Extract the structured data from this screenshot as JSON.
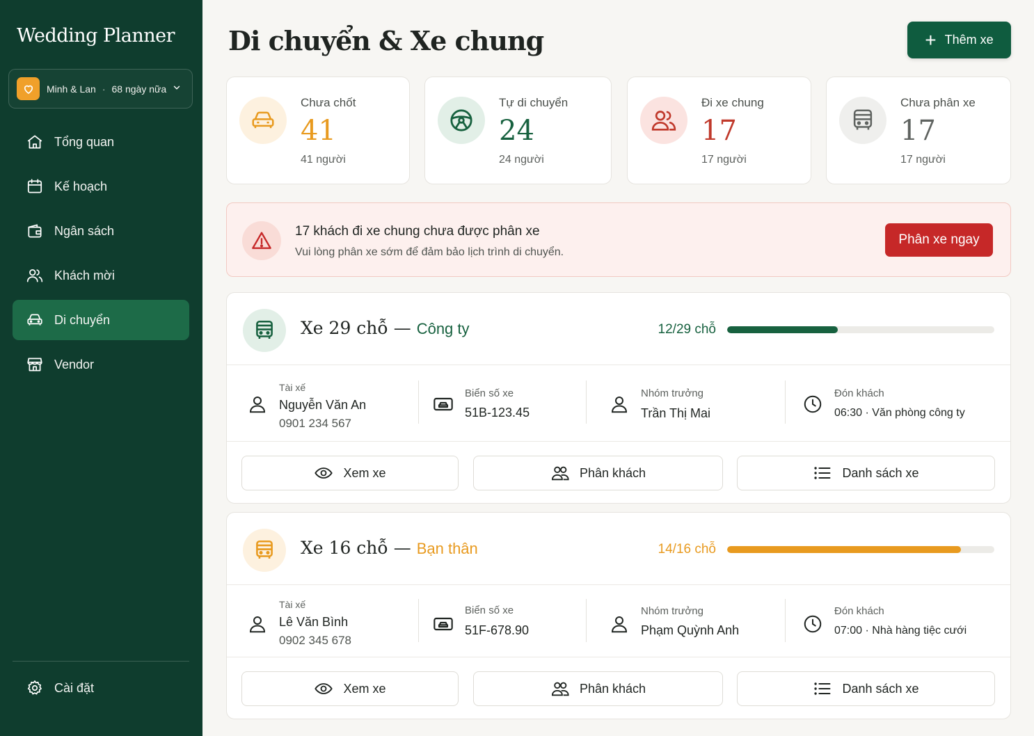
{
  "sidebar": {
    "brand": "Wedding Planner",
    "couple": {
      "names": "Minh & Lan",
      "countdown": "68 ngày nữa"
    },
    "items": [
      {
        "label": "Tổng quan",
        "icon": "home-icon"
      },
      {
        "label": "Kế hoạch",
        "icon": "calendar-icon"
      },
      {
        "label": "Ngân sách",
        "icon": "wallet-icon"
      },
      {
        "label": "Khách mời",
        "icon": "users-icon"
      },
      {
        "label": "Di chuyển",
        "icon": "car-icon",
        "active": true
      },
      {
        "label": "Vendor",
        "icon": "store-icon"
      }
    ],
    "settings": "Cài đặt"
  },
  "header": {
    "title": "Di chuyển & Xe chung",
    "add_button": "Thêm xe"
  },
  "stats": [
    {
      "label": "Chưa chốt",
      "value": "41",
      "sub": "41 người",
      "color": "#e89a1f",
      "icon": "car-icon"
    },
    {
      "label": "Tự di chuyển",
      "value": "24",
      "sub": "24 người",
      "color": "#17613f",
      "icon": "steering-wheel-icon"
    },
    {
      "label": "Đi xe chung",
      "value": "17",
      "sub": "17 người",
      "color": "#c0392b",
      "icon": "users-icon"
    },
    {
      "label": "Chưa phân xe",
      "value": "17",
      "sub": "17 người",
      "color": "#5f6360",
      "icon": "bus-icon"
    }
  ],
  "alert": {
    "title": "17 khách đi xe chung chưa được phân xe",
    "subtitle": "Vui lòng phân xe sớm để đảm bảo lịch trình di chuyển.",
    "button": "Phân xe ngay"
  },
  "vehicles": [
    {
      "name": "Xe 29 chỗ",
      "group": "Công ty",
      "capacity_text": "12/29 chỗ",
      "fill": 0.414,
      "accent": "#17613f",
      "driver_label": "Tài xế",
      "driver_name": "Nguyễn Văn An",
      "driver_phone": "0901 234 567",
      "plate_label": "Biển số xe",
      "plate": "51B-123.45",
      "leader_label": "Nhóm trưởng",
      "leader": "Trần Thị Mai",
      "pickup_label": "Đón khách",
      "pickup": "06:30 · Văn phòng công ty",
      "actions": [
        "Xem xe",
        "Phân khách",
        "Danh sách xe"
      ]
    },
    {
      "name": "Xe 16 chỗ",
      "group": "Bạn thân",
      "capacity_text": "14/16 chỗ",
      "fill": 0.875,
      "accent": "#e89a1f",
      "driver_label": "Tài xế",
      "driver_name": "Lê Văn Bình",
      "driver_phone": "0902 345 678",
      "plate_label": "Biển số xe",
      "plate": "51F-678.90",
      "leader_label": "Nhóm trưởng",
      "leader": "Phạm Quỳnh Anh",
      "pickup_label": "Đón khách",
      "pickup": "07:00 · Nhà hàng tiệc cưới",
      "actions": [
        "Xem xe",
        "Phân khách",
        "Danh sách xe"
      ]
    }
  ]
}
